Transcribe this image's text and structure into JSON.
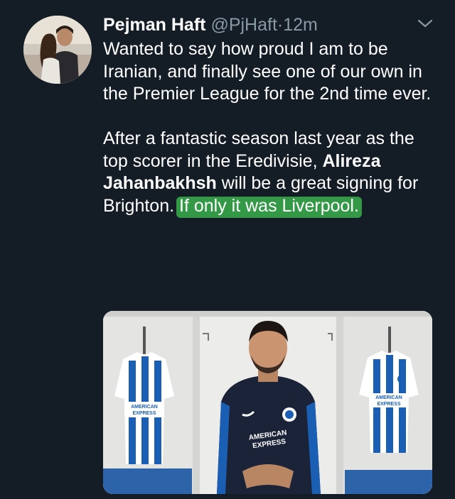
{
  "tweet": {
    "author_name": "Pejman Haft",
    "handle": "@PjHaft",
    "separator": "·",
    "time": "12m",
    "para1": "Wanted to say how proud I am to be Iranian, and finally see one of our own in the Premier League for the 2nd time ever.",
    "para2_a": "After a fantastic season last year as the top scorer in the Eredivisie,",
    "para2_bold": "Alireza Jahanbakhsh",
    "para2_b": "will be a great signing for Brighton.",
    "highlight": "If only it was Liverpool."
  },
  "media": {
    "sponsor_left": "AMERICAN EXPRESS",
    "sponsor_center": "AMERICAN EXPRESS",
    "sponsor_right": "AMERICAN EXPRESS"
  },
  "colors": {
    "background": "#141d26",
    "secondary_text": "#8899a6",
    "highlight": "#35a048",
    "kit_blue": "#1b5fb5",
    "kit_navy": "#1a2338"
  }
}
